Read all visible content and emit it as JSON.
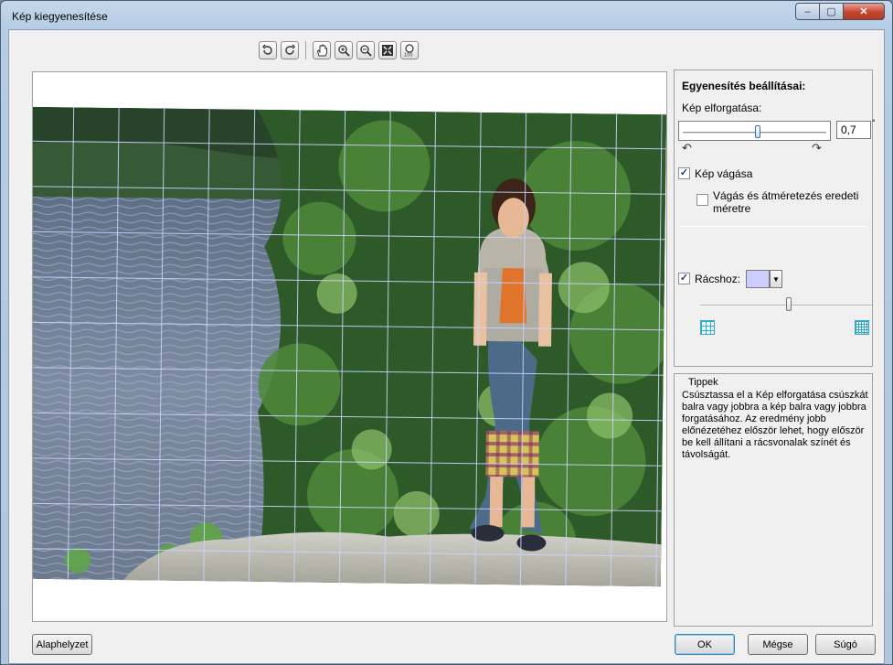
{
  "window": {
    "title": "Kép kiegyenesítése"
  },
  "titlebar_buttons": {
    "minimize": "–",
    "maximize": "▢",
    "close": "✕"
  },
  "toolbar": {
    "icons": [
      "rotate-left-icon",
      "rotate-right-icon",
      "hand-icon",
      "zoom-in-icon",
      "zoom-out-icon",
      "zoom-fit-icon",
      "actual-size-icon"
    ]
  },
  "settings": {
    "heading": "Egyenesítés beállításai:",
    "rotate_label": "Kép elforgatása:",
    "rotate_value": "0,7",
    "rotate_unit": "°",
    "rotate_slider_fraction": 0.52,
    "crop_label": "Kép vágása",
    "crop_checked": true,
    "resize_label": "Vágás és átméretezés eredeti méretre",
    "resize_checked": false,
    "grid_label": "Rácshoz:",
    "grid_checked": true,
    "grid_color": "#ccccff",
    "grid_spacing_fraction": 0.5
  },
  "tips": {
    "title": "Tippek",
    "text": "Csúsztassa el a Kép elforgatása csúszkát balra vagy jobbra a kép balra vagy jobbra forgatásához. Az eredmény jobb előnézetéhez először lehet, hogy először be kell állítani a rácsvonalak színét és távolságát."
  },
  "buttons": {
    "reset": "Alaphelyzet",
    "ok": "OK",
    "cancel": "Mégse",
    "help": "Súgó"
  }
}
